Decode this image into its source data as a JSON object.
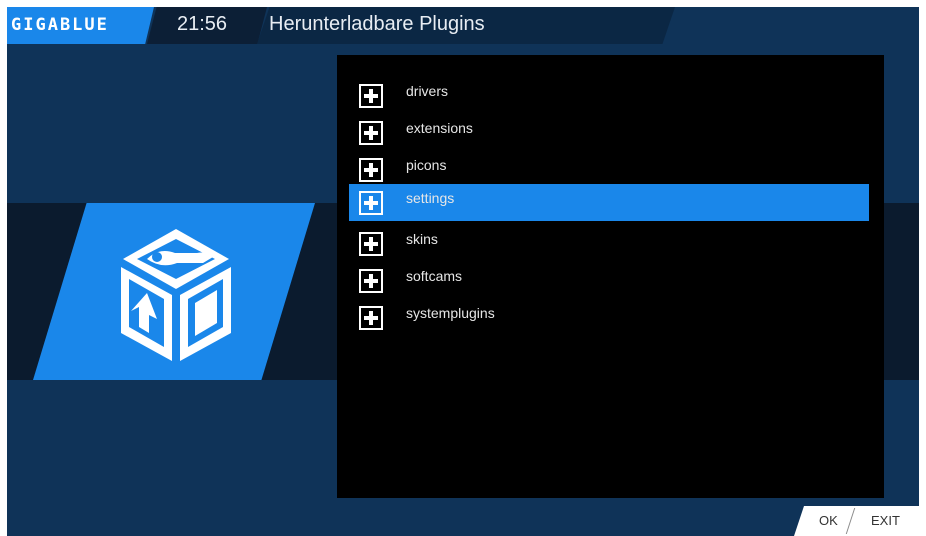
{
  "header": {
    "logo": "GIGABLUE",
    "clock": "21:56",
    "title": "Herunterladbare Plugins"
  },
  "plugin_list": {
    "selected_index": 3,
    "items": [
      {
        "label": "drivers",
        "icon": "plus-box-icon"
      },
      {
        "label": "extensions",
        "icon": "plus-box-icon"
      },
      {
        "label": "picons",
        "icon": "plus-box-icon"
      },
      {
        "label": "settings",
        "icon": "plus-box-icon"
      },
      {
        "label": "skins",
        "icon": "plus-box-icon"
      },
      {
        "label": "softcams",
        "icon": "plus-box-icon"
      },
      {
        "label": "systemplugins",
        "icon": "plus-box-icon"
      }
    ]
  },
  "footer": {
    "ok": "OK",
    "exit": "EXIT"
  },
  "colors": {
    "accent": "#1a87ea",
    "background": "#0f3358",
    "list_background": "#000000"
  }
}
